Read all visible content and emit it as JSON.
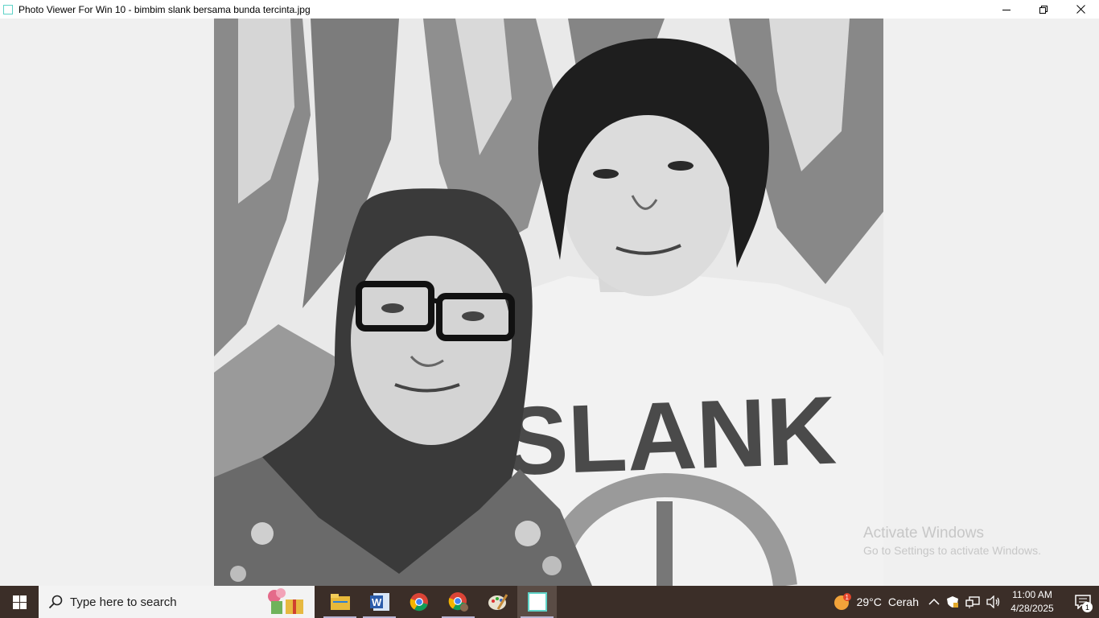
{
  "window": {
    "title": "Photo Viewer For Win 10 - bimbim slank bersama bunda tercinta.jpg"
  },
  "photo": {
    "shirt_text": "SLANK"
  },
  "watermark": {
    "title": "Activate Windows",
    "subtitle": "Go to Settings to activate Windows."
  },
  "taskbar": {
    "search_placeholder": "Type here to search",
    "pinned": [
      "file-explorer",
      "microsoft-word",
      "google-chrome",
      "google-chrome-profile",
      "paint",
      "photo-viewer"
    ],
    "weather": {
      "temperature": "29°C",
      "condition": "Cerah",
      "badge": "1"
    },
    "clock": {
      "time": "11:00 AM",
      "date": "4/28/2025"
    },
    "notifications_count": "1"
  },
  "colors": {
    "taskbar": "#3b2e28",
    "search_bg": "#f3f3f3",
    "app_icon": "#5fd3c8"
  }
}
